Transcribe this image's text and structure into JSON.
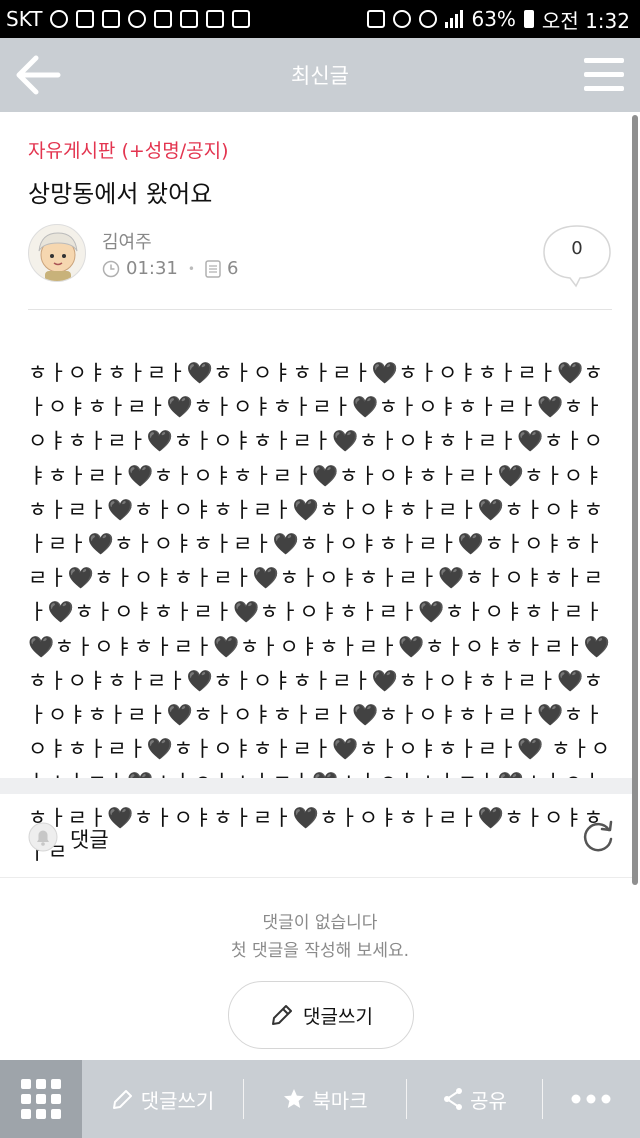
{
  "status_bar": {
    "carrier": "SKT",
    "battery": "63%",
    "time": "오전 1:32"
  },
  "header": {
    "title": "최신글",
    "back_icon": "back-arrow-icon",
    "menu_icon": "hamburger-menu-icon"
  },
  "post": {
    "category": "자유게시판 (+성명/공지)",
    "title": "상망동에서 왔어요",
    "author": "김여주",
    "time": "01:31",
    "views": "6",
    "comment_count": "0",
    "body": "ㅎㅏㅇㅑㅎㅏㄹㅏ🖤ㅎㅏㅇㅑㅎㅏㄹㅏ🖤ㅎㅏㅇㅑㅎㅏㄹㅏ🖤ㅎㅏㅇㅑㅎㅏㄹㅏ🖤ㅎㅏㅇㅑㅎㅏㄹㅏ🖤ㅎㅏㅇㅑㅎㅏㄹㅏ🖤ㅎㅏㅇㅑㅎㅏㄹㅏ🖤ㅎㅏㅇㅑㅎㅏㄹㅏ🖤ㅎㅏㅇㅑㅎㅏㄹㅏ🖤ㅎㅏㅇㅑㅎㅏㄹㅏ🖤ㅎㅏㅇㅑㅎㅏㄹㅏ🖤ㅎㅏㅇㅑㅎㅏㄹㅏ🖤ㅎㅏㅇㅑㅎㅏㄹㅏ🖤ㅎㅏㅇㅑㅎㅏㄹㅏ🖤ㅎㅏㅇㅑㅎㅏㄹㅏ🖤ㅎㅏㅇㅑㅎㅏㄹㅏ🖤ㅎㅏㅇㅑㅎㅏㄹㅏ🖤ㅎㅏㅇㅑㅎㅏㄹㅏ🖤ㅎㅏㅇㅑㅎㅏㄹㅏ🖤ㅎㅏㅇㅑㅎㅏㄹㅏ🖤ㅎㅏㅇㅑㅎㅏㄹㅏ🖤ㅎㅏㅇㅑㅎㅏㄹㅏ🖤ㅎㅏㅇㅑㅎㅏㄹㅏ🖤ㅎㅏㅇㅑㅎㅏㄹㅏ🖤ㅎㅏㅇㅑㅎㅏㄹㅏ🖤ㅎㅏㅇㅑㅎㅏㄹㅏ🖤ㅎㅏㅇㅑㅎㅏㄹㅏ🖤ㅎㅏㅇㅑㅎㅏㄹㅏ🖤ㅎㅏㅇㅑㅎㅏㄹㅏ🖤ㅎㅏㅇㅑㅎㅏㄹㅏ🖤ㅎㅏㅇㅑㅎㅏㄹㅏ🖤ㅎㅏㅇㅑㅎㅏㄹㅏ🖤ㅎㅏㅇㅑㅎㅏㄹㅏ🖤ㅎㅏㅇㅑㅎㅏㄹㅏ🖤ㅎㅏㅇㅑㅎㅏㄹㅏ🖤ㅎㅏㅇㅑㅎㅏㄹㅏ🖤ㅎㅏㅇㅑㅎㅏㄹㅏ🖤 ㅎㅏㅇㅑㅎㅏㄹㅏ🖤ㅎㅏㅇㅑㅎㅏㄹㅏ🖤ㅎㅏㅇㅑㅎㅏㄹㅏ🖤ㅎㅏㅇㅑㅎㅏㄹㅏ🖤ㅎㅏㅇㅑㅎㅏㄹㅏ🖤ㅎㅏㅇㅑㅎㅏㄹㅏ🖤ㅎㅏㅇㅑㅎㅏㄹ"
  },
  "comments": {
    "label": "댓글",
    "empty_line_1": "댓글이 없습니다",
    "empty_line_2": "첫 댓글을 작성해 보세요.",
    "write_button": "댓글쓰기"
  },
  "bottom_bar": {
    "comment_write": "댓글쓰기",
    "bookmark": "북마크",
    "share": "공유"
  },
  "colors": {
    "accent_red": "#e3344f",
    "header_bg": "#c9ced3",
    "grid_button_bg": "#9ea4aa"
  }
}
